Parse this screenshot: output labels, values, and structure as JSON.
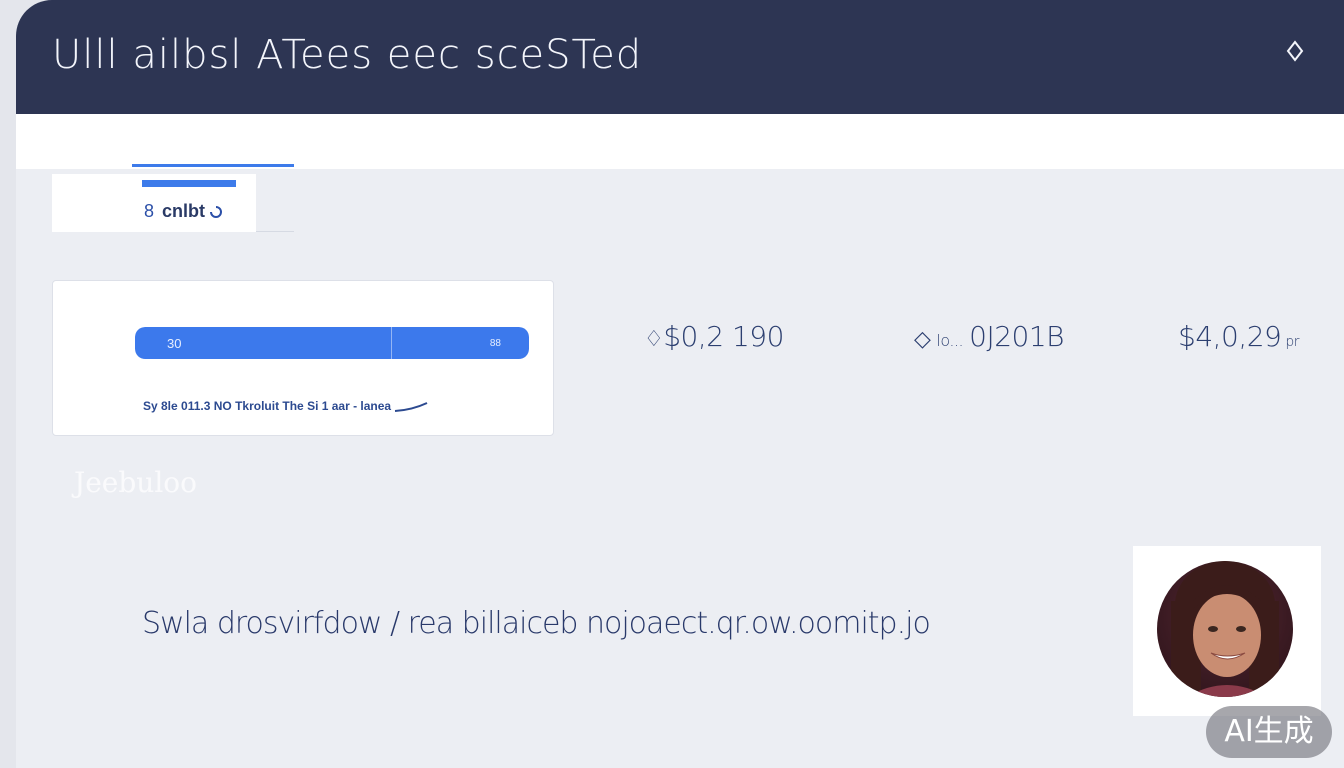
{
  "header": {
    "title": "Ulll ailbsl ATees eec sceSTed",
    "icon": "diamond-outline-icon"
  },
  "tab": {
    "number": "8",
    "label": "cnlbt",
    "icon": "spinner-icon"
  },
  "progress": {
    "left_label": "30",
    "right_label": "88",
    "fill_fraction": 1.0,
    "caption": "Sy 8le 011.3 NO Tkroluit The Si 1 aar - lanea",
    "accent_color": "#3d7bea"
  },
  "stats": [
    {
      "text": "$0,2 190",
      "icon": "ribbon-icon"
    },
    {
      "text": "0J201B",
      "icon": "arrow-icon",
      "prefix": "lo..."
    },
    {
      "text": "$4,0,29",
      "suffix": "pr"
    }
  ],
  "ghost_text": "Jeebuloo",
  "description": "Swla drosvirfdow / rea billaiceb nojoaect.qr.ow.oomitp.jo",
  "avatar": {
    "icon": "user-avatar"
  },
  "badge": {
    "label": "AI生成"
  }
}
